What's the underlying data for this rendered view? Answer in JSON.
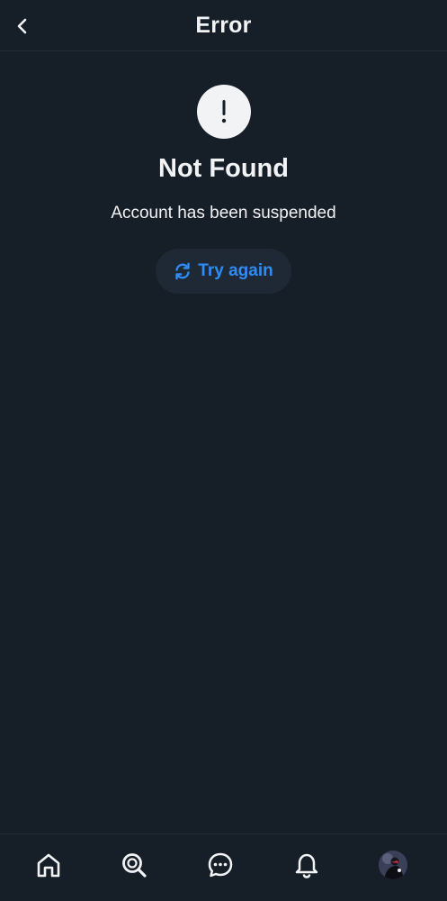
{
  "header": {
    "title": "Error",
    "back_icon": "chevron-left-icon"
  },
  "error": {
    "icon": "exclamation-icon",
    "title": "Not Found",
    "message": "Account has been suspended",
    "retry_label": "Try again",
    "retry_icon": "refresh-icon"
  },
  "bottom_nav": {
    "items": [
      {
        "icon": "home-icon"
      },
      {
        "icon": "search-icon"
      },
      {
        "icon": "chat-icon"
      },
      {
        "icon": "bell-icon"
      },
      {
        "icon": "avatar"
      }
    ]
  },
  "colors": {
    "background": "#161e27",
    "text": "#f1f3f5",
    "accent": "#2f8cf6",
    "button_bg": "#1e2935"
  }
}
